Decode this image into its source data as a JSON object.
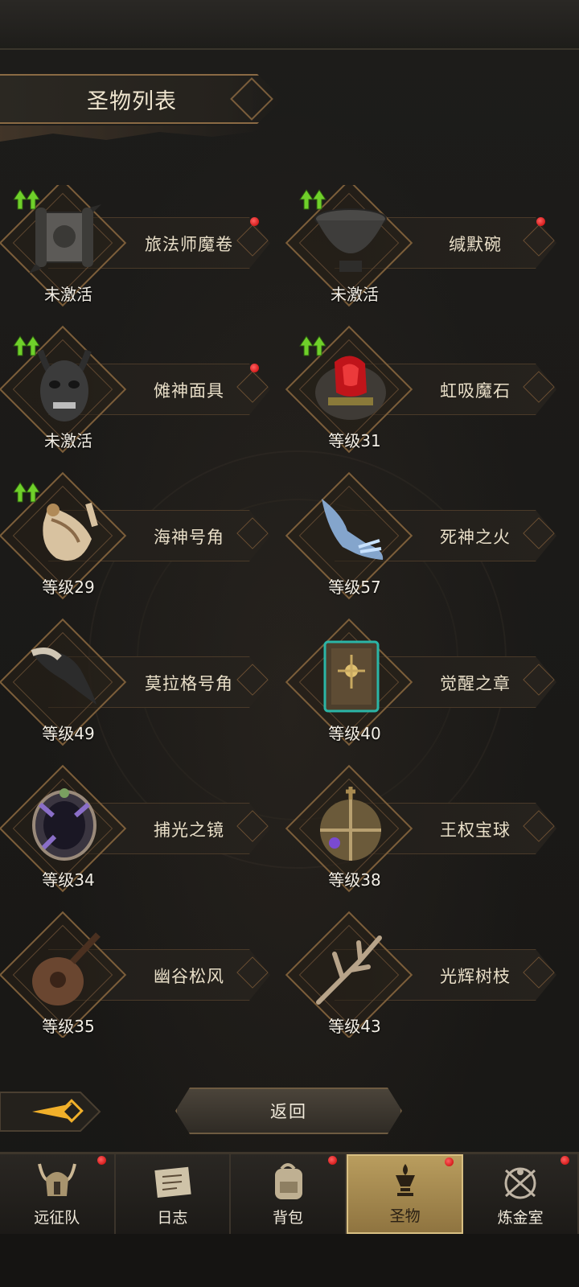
{
  "header": {
    "title": "圣物列表"
  },
  "relics": [
    {
      "name": "旅法师魔卷",
      "status": "未激活",
      "upgrade": true,
      "dot": true,
      "icon": "scroll-icon"
    },
    {
      "name": "缄默碗",
      "status": "未激活",
      "upgrade": true,
      "dot": true,
      "icon": "bowl-icon"
    },
    {
      "name": "傩神面具",
      "status": "未激活",
      "upgrade": true,
      "dot": true,
      "icon": "demon-mask-icon"
    },
    {
      "name": "虹吸魔石",
      "status": "等级31",
      "upgrade": true,
      "dot": false,
      "icon": "red-gem-stone-icon"
    },
    {
      "name": "海神号角",
      "status": "等级29",
      "upgrade": true,
      "dot": false,
      "icon": "conch-horn-icon"
    },
    {
      "name": "死神之火",
      "status": "等级57",
      "upgrade": false,
      "dot": false,
      "icon": "spectral-hand-icon"
    },
    {
      "name": "莫拉格号角",
      "status": "等级49",
      "upgrade": false,
      "dot": false,
      "icon": "war-horn-icon"
    },
    {
      "name": "觉醒之章",
      "status": "等级40",
      "upgrade": false,
      "dot": false,
      "icon": "tome-icon"
    },
    {
      "name": "捕光之镜",
      "status": "等级34",
      "upgrade": false,
      "dot": false,
      "icon": "mirror-icon"
    },
    {
      "name": "王权宝球",
      "status": "等级38",
      "upgrade": false,
      "dot": false,
      "icon": "royal-orb-icon"
    },
    {
      "name": "幽谷松风",
      "status": "等级35",
      "upgrade": false,
      "dot": false,
      "icon": "lute-icon"
    },
    {
      "name": "光辉树枝",
      "status": "等级43",
      "upgrade": false,
      "dot": false,
      "icon": "branch-icon"
    }
  ],
  "actions": {
    "return_label": "返回"
  },
  "nav": [
    {
      "label": "远征队",
      "icon": "helmet-icon",
      "dot": true,
      "active": false
    },
    {
      "label": "日志",
      "icon": "journal-icon",
      "dot": false,
      "active": false
    },
    {
      "label": "背包",
      "icon": "backpack-icon",
      "dot": true,
      "active": false
    },
    {
      "label": "圣物",
      "icon": "relic-chalice-icon",
      "dot": true,
      "active": true
    },
    {
      "label": "炼金室",
      "icon": "alchemy-icon",
      "dot": true,
      "active": false
    }
  ],
  "colors": {
    "accent": "#7c5e3a",
    "active_tab": "#b99d5e",
    "badge": "#d10000",
    "upgrade": "#6fd02a"
  }
}
